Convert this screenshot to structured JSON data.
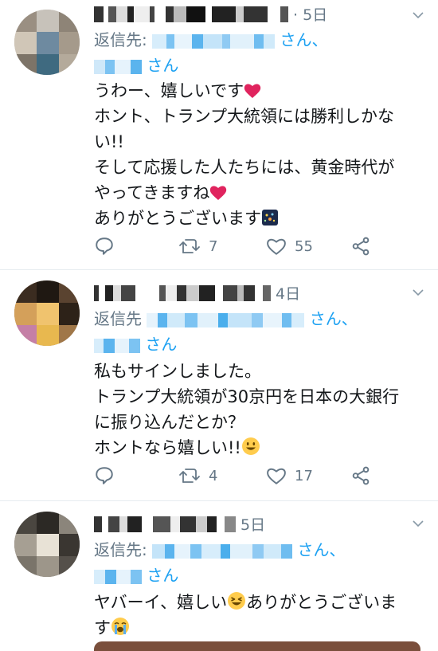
{
  "tweets": [
    {
      "time": "· 5日",
      "reply_prefix": "返信先:",
      "reply_suffix_1": "さん、",
      "reply_suffix_2": "さん",
      "lines": [
        "うわー、嬉しいです",
        "ホント、トランプ大統領には勝利しかな",
        "い!!",
        "そして応援した人たちには、黄金時代が",
        "やってきますね",
        "ありがとうございます"
      ],
      "retweets": "7",
      "likes": "55"
    },
    {
      "time": "4日",
      "reply_prefix": "返信先",
      "reply_suffix_1": "さん、",
      "reply_suffix_2": "さん",
      "lines": [
        "私もサインしました。",
        "トランプ大統領が30京円を日本の大銀行",
        "に振り込んだとか？",
        "ホントなら嬉しい!!"
      ],
      "retweets": "4",
      "likes": "17"
    },
    {
      "time": "5日",
      "reply_prefix": "返信先:",
      "reply_suffix_1": "さん、",
      "reply_suffix_2": "さん",
      "lines": [
        "ヤバーイ、嬉しい",
        "ありがとうございま",
        "す"
      ]
    }
  ],
  "icons": [
    "reply-icon",
    "retweet-icon",
    "like-icon",
    "share-icon",
    "chevron-down-icon",
    "heart-emoji",
    "fireworks-emoji",
    "smile-emoji",
    "laugh-emoji",
    "cry-emoji"
  ],
  "colors": {
    "accent": "#1da1f2",
    "muted": "#657786",
    "text": "#14171a",
    "heart": "#e0245e"
  }
}
